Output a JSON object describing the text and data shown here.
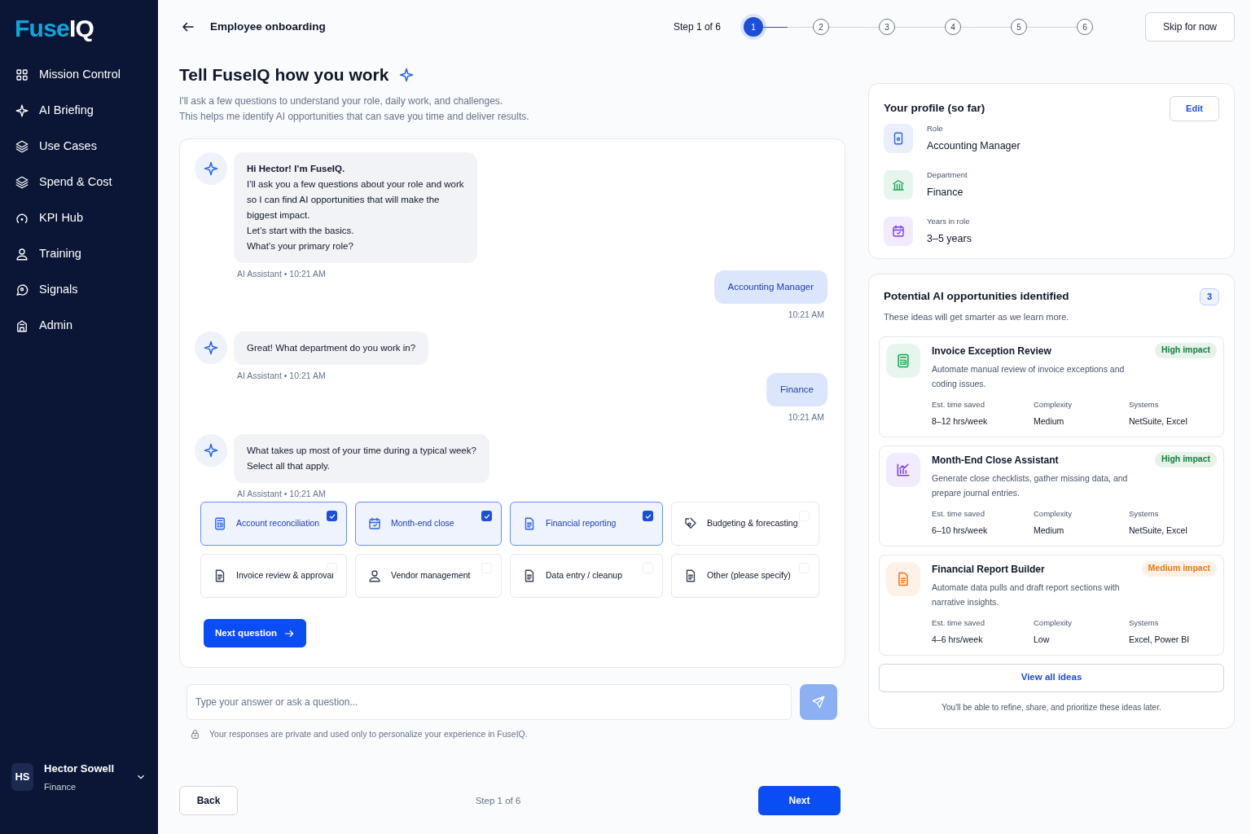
{
  "sidebar": {
    "logo_primary": "Fuse",
    "logo_secondary": "IQ",
    "items": [
      {
        "label": "Mission Control"
      },
      {
        "label": "AI Briefing"
      },
      {
        "label": "Use Cases"
      },
      {
        "label": "Spend & Cost"
      },
      {
        "label": "KPI Hub"
      },
      {
        "label": "Training"
      },
      {
        "label": "Signals"
      },
      {
        "label": "Admin"
      }
    ],
    "user": {
      "initials": "HS",
      "name": "Hector Sowell",
      "department": "Finance"
    }
  },
  "header": {
    "title": "Employee onboarding",
    "step_label": "Step 1 of 6",
    "steps": [
      {
        "label": "1",
        "selected": true
      },
      {
        "label": "2",
        "selected": false
      },
      {
        "label": "3",
        "selected": false
      },
      {
        "label": "4",
        "selected": false
      },
      {
        "label": "5",
        "selected": false
      },
      {
        "label": "6",
        "selected": false
      }
    ],
    "skip_button": "Skip for now"
  },
  "intro": {
    "heading": "Tell FuseIQ how you work",
    "lines": [
      "I'll ask a few questions to understand your role, daily work, and challenges.",
      "This helps me identify AI opportunities that can save you time and deliver results."
    ]
  },
  "chat": [
    {
      "kind": "assistant",
      "title": "Hi Hector! I’m FuseIQ.",
      "lines": [
        "I’ll ask you a few questions about your role and work",
        "so I can find AI opportunities that will make the",
        "biggest impact.",
        "Let’s start with the basics.",
        "What’s your primary role?"
      ],
      "meta": "AI Assistant • 10:21 AM"
    },
    {
      "kind": "user",
      "lines": [
        "Accounting Manager"
      ],
      "meta": "10:21 AM"
    },
    {
      "kind": "assistant",
      "lines": [
        "Great! What department do you work in?"
      ],
      "meta": "AI Assistant • 10:21 AM"
    },
    {
      "kind": "user",
      "lines": [
        "Finance"
      ],
      "meta": "10:21 AM"
    },
    {
      "kind": "assistant",
      "lines": [
        "What takes up most of your time during a typical week?",
        "Select all that apply."
      ],
      "meta": "AI Assistant • 10:21 AM"
    }
  ],
  "options": [
    {
      "label": "Account reconciliation",
      "checked": true
    },
    {
      "label": "Month-end close",
      "checked": true
    },
    {
      "label": "Financial reporting",
      "checked": true
    },
    {
      "label": "Budgeting & forecasting",
      "checked": false
    },
    {
      "label": "Invoice review & approval",
      "checked": false
    },
    {
      "label": "Vendor management",
      "checked": false
    },
    {
      "label": "Data entry / cleanup",
      "checked": false
    },
    {
      "label": "Other (please specify)",
      "checked": false
    }
  ],
  "next_question_button": "Next question",
  "composer": {
    "placeholder": "Type your answer or ask a question...",
    "privacy_note": "Your responses are private and used only to personalize your experience in FuseIQ."
  },
  "footer": {
    "back_button": "Back",
    "step_label": "Step 1 of 6",
    "next_button": "Next"
  },
  "profile": {
    "title": "Your profile (so far)",
    "edit_button": "Edit",
    "fields": [
      {
        "label": "Role",
        "value": "Accounting Manager",
        "color": "#2563eb"
      },
      {
        "label": "Department",
        "value": "Finance",
        "color": "#16a34a"
      },
      {
        "label": "Years in role",
        "value": "3–5 years",
        "color": "#7c3aed"
      }
    ]
  },
  "opportunities": {
    "title": "Potential AI opportunities identified",
    "count": "3",
    "subtitle": "These ideas will get smarter as we learn more.",
    "items": [
      {
        "title": "Invoice Exception Review",
        "impact": {
          "label": "High impact",
          "color": "#15803d"
        },
        "color": "#16a34a",
        "description": "Automate manual review of invoice exceptions and coding issues.",
        "stats": [
          {
            "label": "Est. time saved",
            "value": "8–12 hrs/week"
          },
          {
            "label": "Complexity",
            "value": "Medium"
          },
          {
            "label": "Systems",
            "value": "NetSuite, Excel"
          }
        ]
      },
      {
        "title": "Month-End Close Assistant",
        "impact": {
          "label": "High impact",
          "color": "#15803d"
        },
        "color": "#7c3aed",
        "description": "Generate close checklists, gather missing data, and prepare journal entries.",
        "stats": [
          {
            "label": "Est. time saved",
            "value": "6–10 hrs/week"
          },
          {
            "label": "Complexity",
            "value": "Medium"
          },
          {
            "label": "Systems",
            "value": "NetSuite, Excel"
          }
        ]
      },
      {
        "title": "Financial Report Builder",
        "impact": {
          "label": "Medium impact",
          "color": "#ea7a12"
        },
        "color": "#f97316",
        "description": "Automate data pulls and draft report sections with narrative insights.",
        "stats": [
          {
            "label": "Est. time saved",
            "value": "4–6 hrs/week"
          },
          {
            "label": "Complexity",
            "value": "Low"
          },
          {
            "label": "Systems",
            "value": "Excel, Power BI"
          }
        ]
      }
    ],
    "view_all_button": "View all ideas",
    "note": "You'll be able to refine, share, and prioritize these ideas later."
  }
}
